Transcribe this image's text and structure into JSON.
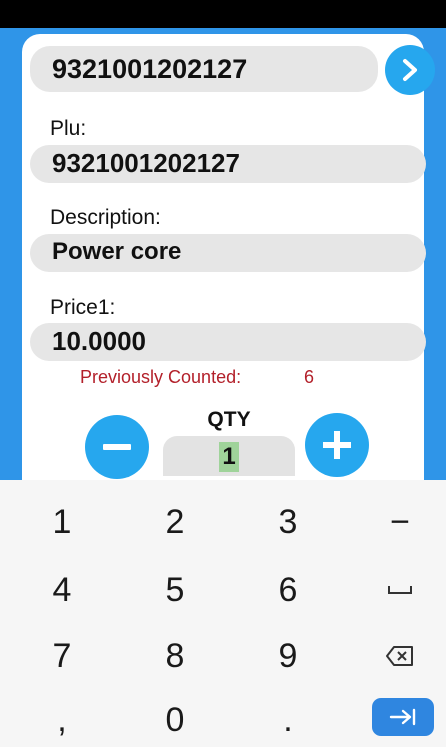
{
  "barcode": {
    "value": "9321001202127",
    "go_icon": "chevron-right-icon"
  },
  "fields": {
    "plu": {
      "label": "Plu:",
      "value": "9321001202127"
    },
    "description": {
      "label": "Description:",
      "value": "Power core"
    },
    "price": {
      "label": "Price1:",
      "value": "10.0000"
    }
  },
  "previously_counted": {
    "label": "Previously Counted:",
    "value": "6"
  },
  "qty": {
    "label": "QTY",
    "value": "1",
    "minus_icon": "minus-icon",
    "plus_icon": "plus-icon"
  },
  "keyboard": {
    "keys": [
      "1",
      "2",
      "3",
      "−",
      "4",
      "5",
      "6",
      "7",
      "8",
      "9",
      ",",
      "0",
      "."
    ],
    "space_icon": "space-icon",
    "backspace_icon": "backspace-icon",
    "next_icon": "tab-next-icon"
  },
  "colors": {
    "accent": "#26a7ee",
    "header": "#2f95e8",
    "warning_text": "#b3202a",
    "qty_highlight": "#9fd39a"
  }
}
